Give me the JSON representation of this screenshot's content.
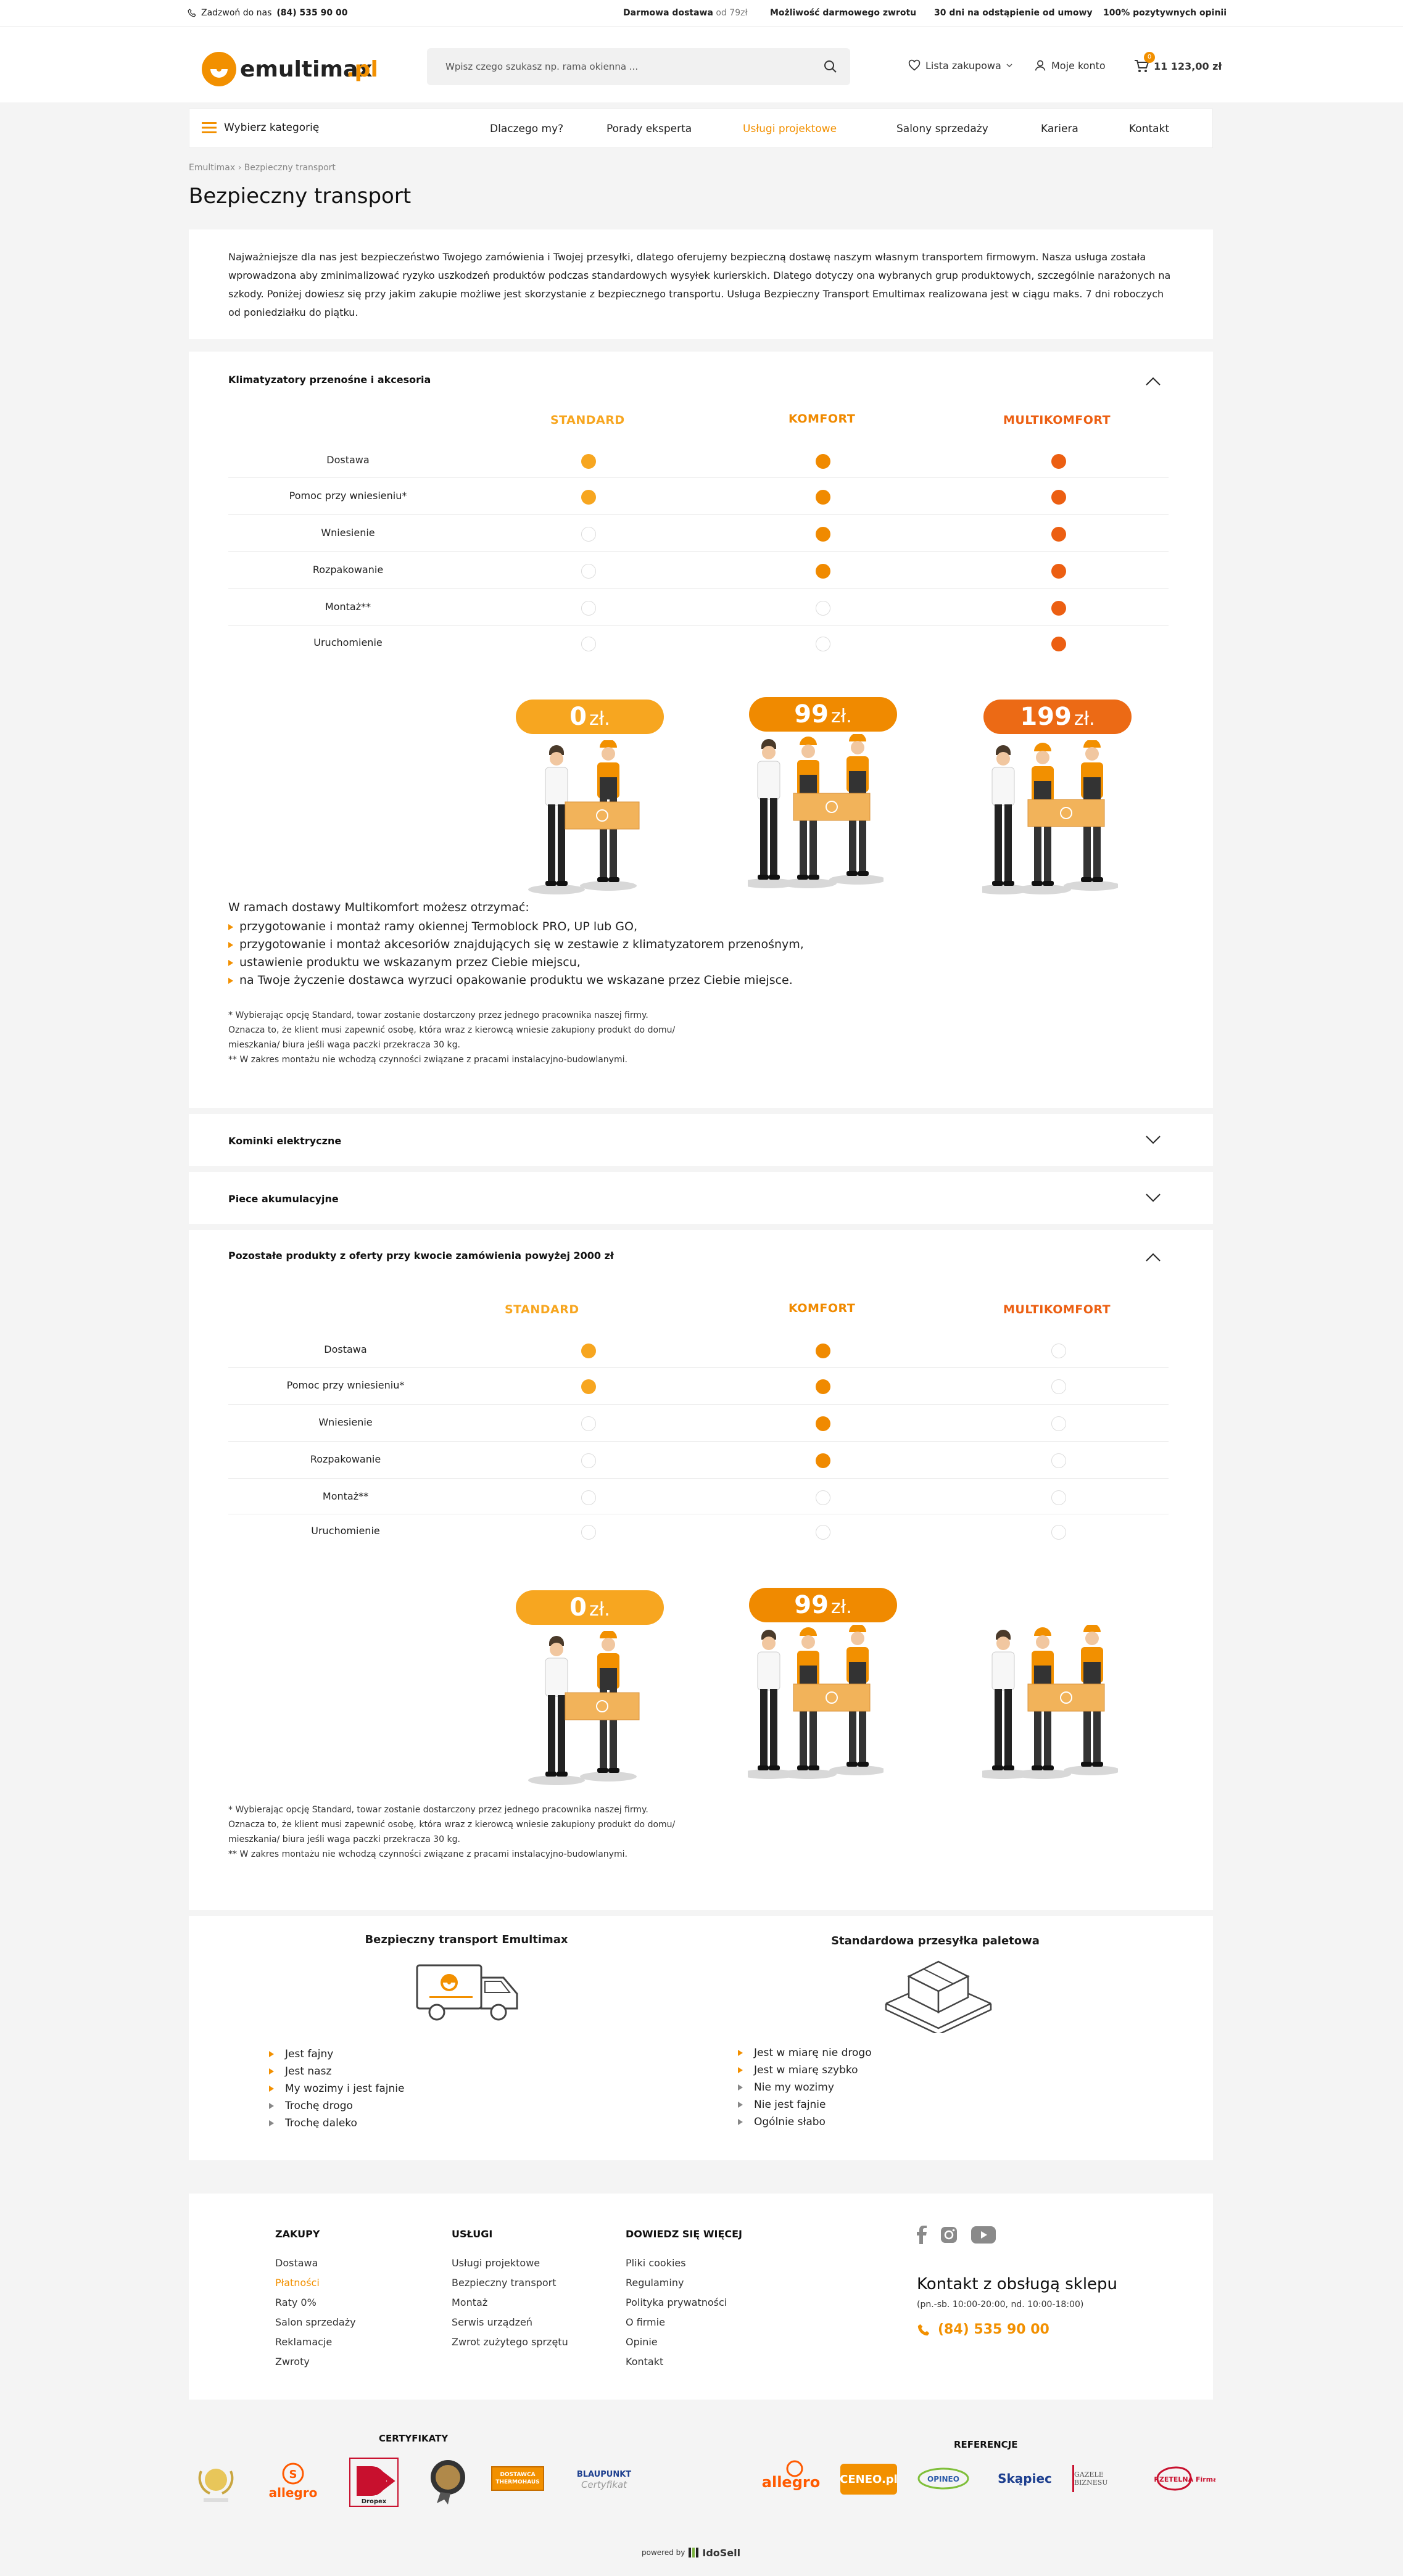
{
  "topbar": {
    "phone_prefix": "Zadzwoń do nas",
    "phone": "(84) 535 90 00",
    "usp1_bold": "Darmowa dostawa",
    "usp1_light": "od 79zł",
    "usp2": "Możliwość darmowego zwrotu",
    "usp3": "30 dni na odstąpienie od umowy",
    "usp4": "100% pozytywnych opinii"
  },
  "header": {
    "logo_text": "emultimax",
    "logo_tld": ".pl",
    "search_placeholder": "Wpisz czego szukasz np. rama okienna ...",
    "wishlist": "Lista zakupowa",
    "account": "Moje konto",
    "cart_count": "0",
    "cart_total": "11 123,00 zł"
  },
  "nav": {
    "category": "Wybierz kategorię",
    "items": [
      "Dlaczego my?",
      "Porady eksperta",
      "Usługi projektowe",
      "Salony sprzedaży",
      "Kariera",
      "Kontakt"
    ],
    "active_index": 2
  },
  "breadcrumb": "Emultimax › Bezpieczny transport",
  "page_title": "Bezpieczny transport",
  "intro": "Najważniejsze dla nas jest bezpieczeństwo Twojego zamówienia i Twojej przesyłki, dlatego oferujemy bezpieczną dostawę naszym własnym transportem firmowym. Nasza usługa została wprowadzona aby zminimalizować ryzyko uszkodzeń produktów podczas standardowych wysyłek kurierskich. Dlatego dotyczy ona wybranych grup produktowych, szczególnie narażonych na szkody. Poniżej dowiesz się przy jakim zakupie możliwe jest skorzystanie z bezpiecznego transportu. Usługa Bezpieczny Transport Emultimax realizowana jest w ciągu maks. 7 dni roboczych od poniedziałku do piątku.",
  "columns": [
    "STANDARD",
    "KOMFORT",
    "MULTIKOMFORT"
  ],
  "rows": [
    "Dostawa",
    "Pomoc przy wniesieniu*",
    "Wniesienie",
    "Rozpakowanie",
    "Montaż**",
    "Uruchomienie"
  ],
  "section1": {
    "title": "Klimatyzatory przenośne i akcesoria",
    "matrix": [
      [
        1,
        1,
        1
      ],
      [
        1,
        1,
        1
      ],
      [
        0,
        1,
        1
      ],
      [
        0,
        1,
        1
      ],
      [
        0,
        0,
        1
      ],
      [
        0,
        0,
        1
      ]
    ],
    "prices": [
      "0",
      "99",
      "199"
    ],
    "currency": "zł.",
    "lead": "W ramach dostawy Multikomfort możesz otrzymać:",
    "bullets": [
      "przygotowanie i montaż ramy okiennej Termoblock PRO, UP lub GO,",
      "przygotowanie i montaż akcesoriów znajdujących się w zestawie z klimatyzatorem przenośnym,",
      "ustawienie produktu we wskazanym przez Ciebie miejscu,",
      "na Twoje życzenie dostawca wyrzuci opakowanie produktu we wskazane przez Ciebie miejsce."
    ],
    "notes": [
      "* Wybierając opcję Standard, towar zostanie dostarczony przez jednego pracownika naszej firmy.",
      "Oznacza to, że klient musi zapewnić osobę, która wraz z kierowcą wniesie zakupiony produkt do domu/",
      "mieszkania/ biura jeśli waga paczki przekracza 30 kg.",
      "** W zakres montażu nie wchodzą czynności związane z pracami instalacyjno-budowlanymi."
    ]
  },
  "section2": {
    "title": "Kominki elektryczne"
  },
  "section3": {
    "title": "Piece akumulacyjne"
  },
  "section4": {
    "title": "Pozostałe produkty z oferty przy kwocie zamówienia powyżej 2000 zł",
    "matrix": [
      [
        1,
        1,
        0
      ],
      [
        1,
        1,
        0
      ],
      [
        0,
        1,
        0
      ],
      [
        0,
        1,
        0
      ],
      [
        0,
        0,
        0
      ],
      [
        0,
        0,
        0
      ]
    ],
    "prices": [
      "0",
      "99"
    ],
    "currency": "zł.",
    "notes": [
      "* Wybierając opcję Standard, towar zostanie dostarczony przez jednego pracownika naszej firmy.",
      "Oznacza to, że klient musi zapewnić osobę, która wraz z kierowcą wniesie zakupiony produkt do domu/",
      "mieszkania/ biura jeśli waga paczki przekracza 30 kg.",
      "** W zakres montażu nie wchodzą czynności związane z pracami instalacyjno-budowlanymi."
    ]
  },
  "comparison": {
    "left_title": "Bezpieczny transport Emultimax",
    "left_plus": [
      "Jest fajny",
      "Jest nasz",
      "My wozimy i jest fajnie"
    ],
    "left_minus": [
      "Trochę drogo",
      "Trochę daleko"
    ],
    "right_title": "Standardowa przesyłka paletowa",
    "right_plus": [
      "Jest w miarę nie drogo",
      "Jest w miarę szybko"
    ],
    "right_minus": [
      "Nie my wozimy",
      "Nie jest fajnie",
      "Ogólnie słabo"
    ]
  },
  "footer": {
    "col1_title": "ZAKUPY",
    "col1": [
      "Dostawa",
      "Płatności",
      "Raty 0%",
      "Salon sprzedaży",
      "Reklamacje",
      "Zwroty"
    ],
    "col2_title": "USŁUGI",
    "col2": [
      "Usługi projektowe",
      "Bezpieczny transport",
      "Montaż",
      "Serwis urządzeń",
      "Zwrot zużytego sprzętu"
    ],
    "col3_title": "DOWIEDZ SIĘ WIĘCEJ",
    "col3": [
      "Pliki cookies",
      "Regulaminy",
      "Polityka prywatności",
      "O firmie",
      "Opinie",
      "Kontakt"
    ],
    "contact_title": "Kontakt z obsługą sklepu",
    "contact_hours": "(pn.-sb. 10:00-20:00, nd. 10:00-18:00)",
    "contact_phone": "(84) 535 90 00"
  },
  "certificates": {
    "title": "CERTYFIKATY",
    "items": [
      "allegro",
      "Dropex",
      "DOSTAWCA THERMOHAUS",
      "BLAUPUNKT",
      "Certyfikat"
    ]
  },
  "references": {
    "title": "REFERENCJE",
    "items": [
      "allegro",
      "CENEO.pl",
      "OPINEO",
      "Skąpiec",
      "GAZELE BIZNESU",
      "RZETELNA Firma"
    ]
  },
  "powered": {
    "label": "powered by",
    "brand": "IdoSell"
  },
  "colors": {
    "accent": "#f29000",
    "standard": "#f7a620",
    "komfort": "#f08a00",
    "multikomfort": "#ec5f12"
  }
}
